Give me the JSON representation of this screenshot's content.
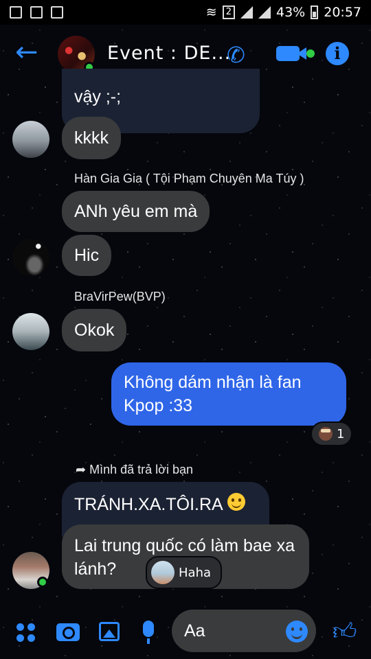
{
  "status_bar": {
    "battery": "43%",
    "time": "20:57",
    "sim": "2"
  },
  "header": {
    "title": "Event : DE...",
    "icons": [
      "back-arrow-icon",
      "phone-icon",
      "video-icon",
      "info-icon"
    ]
  },
  "messages": [
    {
      "id": "m1",
      "text": "vậy ;-;",
      "direction": "incoming"
    },
    {
      "id": "m2",
      "text": "kkkk",
      "direction": "incoming"
    },
    {
      "id": "m3",
      "sender": "Hàn Gia Gia ( Tội Phạm Chuyên Ma Túy )",
      "text": "ANh yêu em mà",
      "direction": "incoming"
    },
    {
      "id": "m4",
      "text": "Hic",
      "direction": "incoming"
    },
    {
      "id": "m5",
      "sender": "BraVirPew(BVP)",
      "text": "Okok",
      "direction": "incoming"
    },
    {
      "id": "m6",
      "text": "Không dám nhận là fan Kpop :33",
      "direction": "outgoing",
      "reaction_count": "1"
    },
    {
      "id": "m7",
      "reply_label": "Mình đã trả lời bạn",
      "quoted_text": "TRÁNH.XA.TÔI.RA",
      "text": "Lai trung quốc có làm bae xa lánh?",
      "direction": "incoming",
      "reaction_label": "Haha"
    }
  ],
  "composer": {
    "placeholder": "Aa"
  },
  "colors": {
    "accent": "#2e89ff",
    "outgoing_bubble": "#2f66e8",
    "incoming_bubble": "#3a3b3c",
    "online": "#31cc46"
  }
}
